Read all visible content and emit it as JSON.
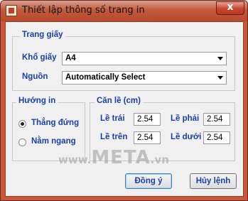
{
  "window": {
    "title": "Thiết lập thông số trang in",
    "close_glyph": "x",
    "icon": "app-icon"
  },
  "paper": {
    "legend": "Trang giấy",
    "size_label": "Khổ giấy",
    "size_value": "A4",
    "source_label": "Nguồn",
    "source_value": "Automatically Select"
  },
  "orientation": {
    "legend": "Hướng in",
    "options": [
      {
        "label": "Thẳng đứng",
        "checked": true
      },
      {
        "label": "Nằm ngang",
        "checked": false
      }
    ]
  },
  "margins": {
    "legend": "Căn lề (cm)",
    "left_label": "Lề trái",
    "left_value": "2.54",
    "right_label": "Lề phải",
    "right_value": "2.54",
    "top_label": "Lề trên",
    "top_value": "2.54",
    "bottom_label": "Lề dưới",
    "bottom_value": "2.54"
  },
  "buttons": {
    "ok": "Đồng ý",
    "cancel": "Hủy lệnh"
  },
  "watermark": {
    "prefix": "www.",
    "brand": "META",
    "suffix": ".vn"
  }
}
